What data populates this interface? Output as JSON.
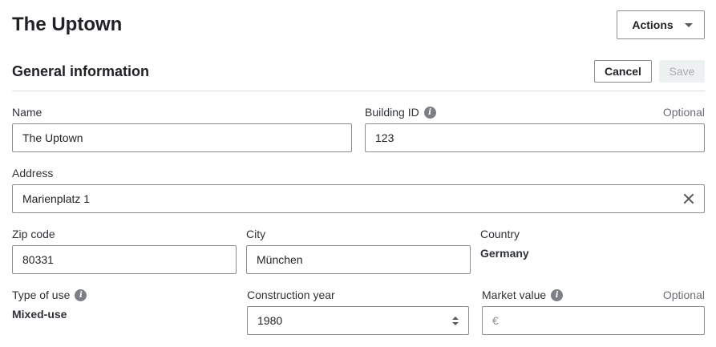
{
  "header": {
    "title": "The Uptown",
    "actions_label": "Actions"
  },
  "section": {
    "title": "General information",
    "cancel_label": "Cancel",
    "save_label": "Save"
  },
  "fields": {
    "name": {
      "label": "Name",
      "value": "The Uptown"
    },
    "building_id": {
      "label": "Building ID",
      "optional": "Optional",
      "value": "123"
    },
    "address": {
      "label": "Address",
      "value": "Marienplatz 1"
    },
    "zip_code": {
      "label": "Zip code",
      "value": "80331"
    },
    "city": {
      "label": "City",
      "value": "München"
    },
    "country": {
      "label": "Country",
      "value": "Germany"
    },
    "type_of_use": {
      "label": "Type of use",
      "value": "Mixed-use"
    },
    "construction_year": {
      "label": "Construction year",
      "value": "1980"
    },
    "market_value": {
      "label": "Market value",
      "optional": "Optional",
      "currency": "€",
      "value": ""
    }
  },
  "icons": {
    "info": "info-icon",
    "clear": "close-icon",
    "stepper": "stepper-icon",
    "caret": "chevron-down-icon"
  }
}
